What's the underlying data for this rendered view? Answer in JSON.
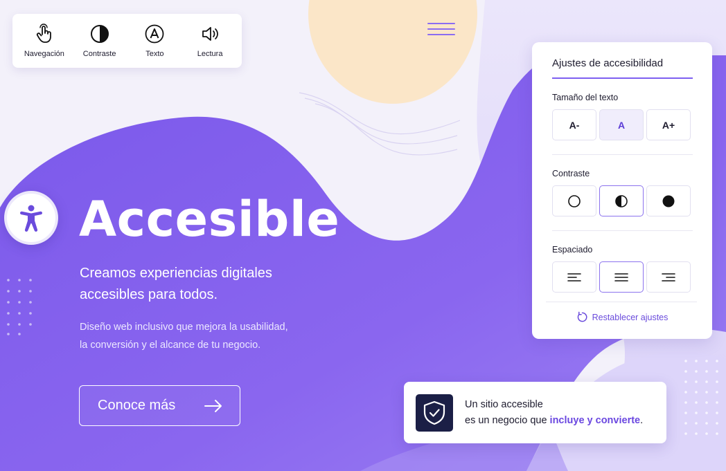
{
  "toolbar": {
    "items": [
      {
        "label": "Navegación",
        "icon": "hand-pointer-icon"
      },
      {
        "label": "Contraste",
        "icon": "contrast-icon"
      },
      {
        "label": "Texto",
        "icon": "text-a-icon"
      },
      {
        "label": "Lectura",
        "icon": "speaker-icon"
      }
    ]
  },
  "hero": {
    "title": "Accesible",
    "subtitle_line1": "Creamos experiencias digitales",
    "subtitle_line2": "accesibles para todos.",
    "desc_line1": "Diseño web inclusivo que mejora la usabilidad,",
    "desc_line2": "la conversión y el alcance de tu negocio.",
    "cta_label": "Conoce más"
  },
  "panel": {
    "title": "Ajustes de accesibilidad",
    "text_size": {
      "label": "Tamaño del texto",
      "options": [
        "A-",
        "A",
        "A+"
      ],
      "selected": "A"
    },
    "contrast": {
      "label": "Contraste",
      "selected": "half"
    },
    "spacing": {
      "label": "Espaciado",
      "selected": "center"
    },
    "reset_label": "Restablecer ajustes"
  },
  "info_card": {
    "line1": "Un sitio accesible",
    "line2_prefix": "es un negocio que ",
    "line2_highlight": "incluye y convierte",
    "line2_suffix": "."
  },
  "colors": {
    "accent": "#7b5cf0",
    "deep": "#1b1f46",
    "peach": "#fbe6c8"
  }
}
